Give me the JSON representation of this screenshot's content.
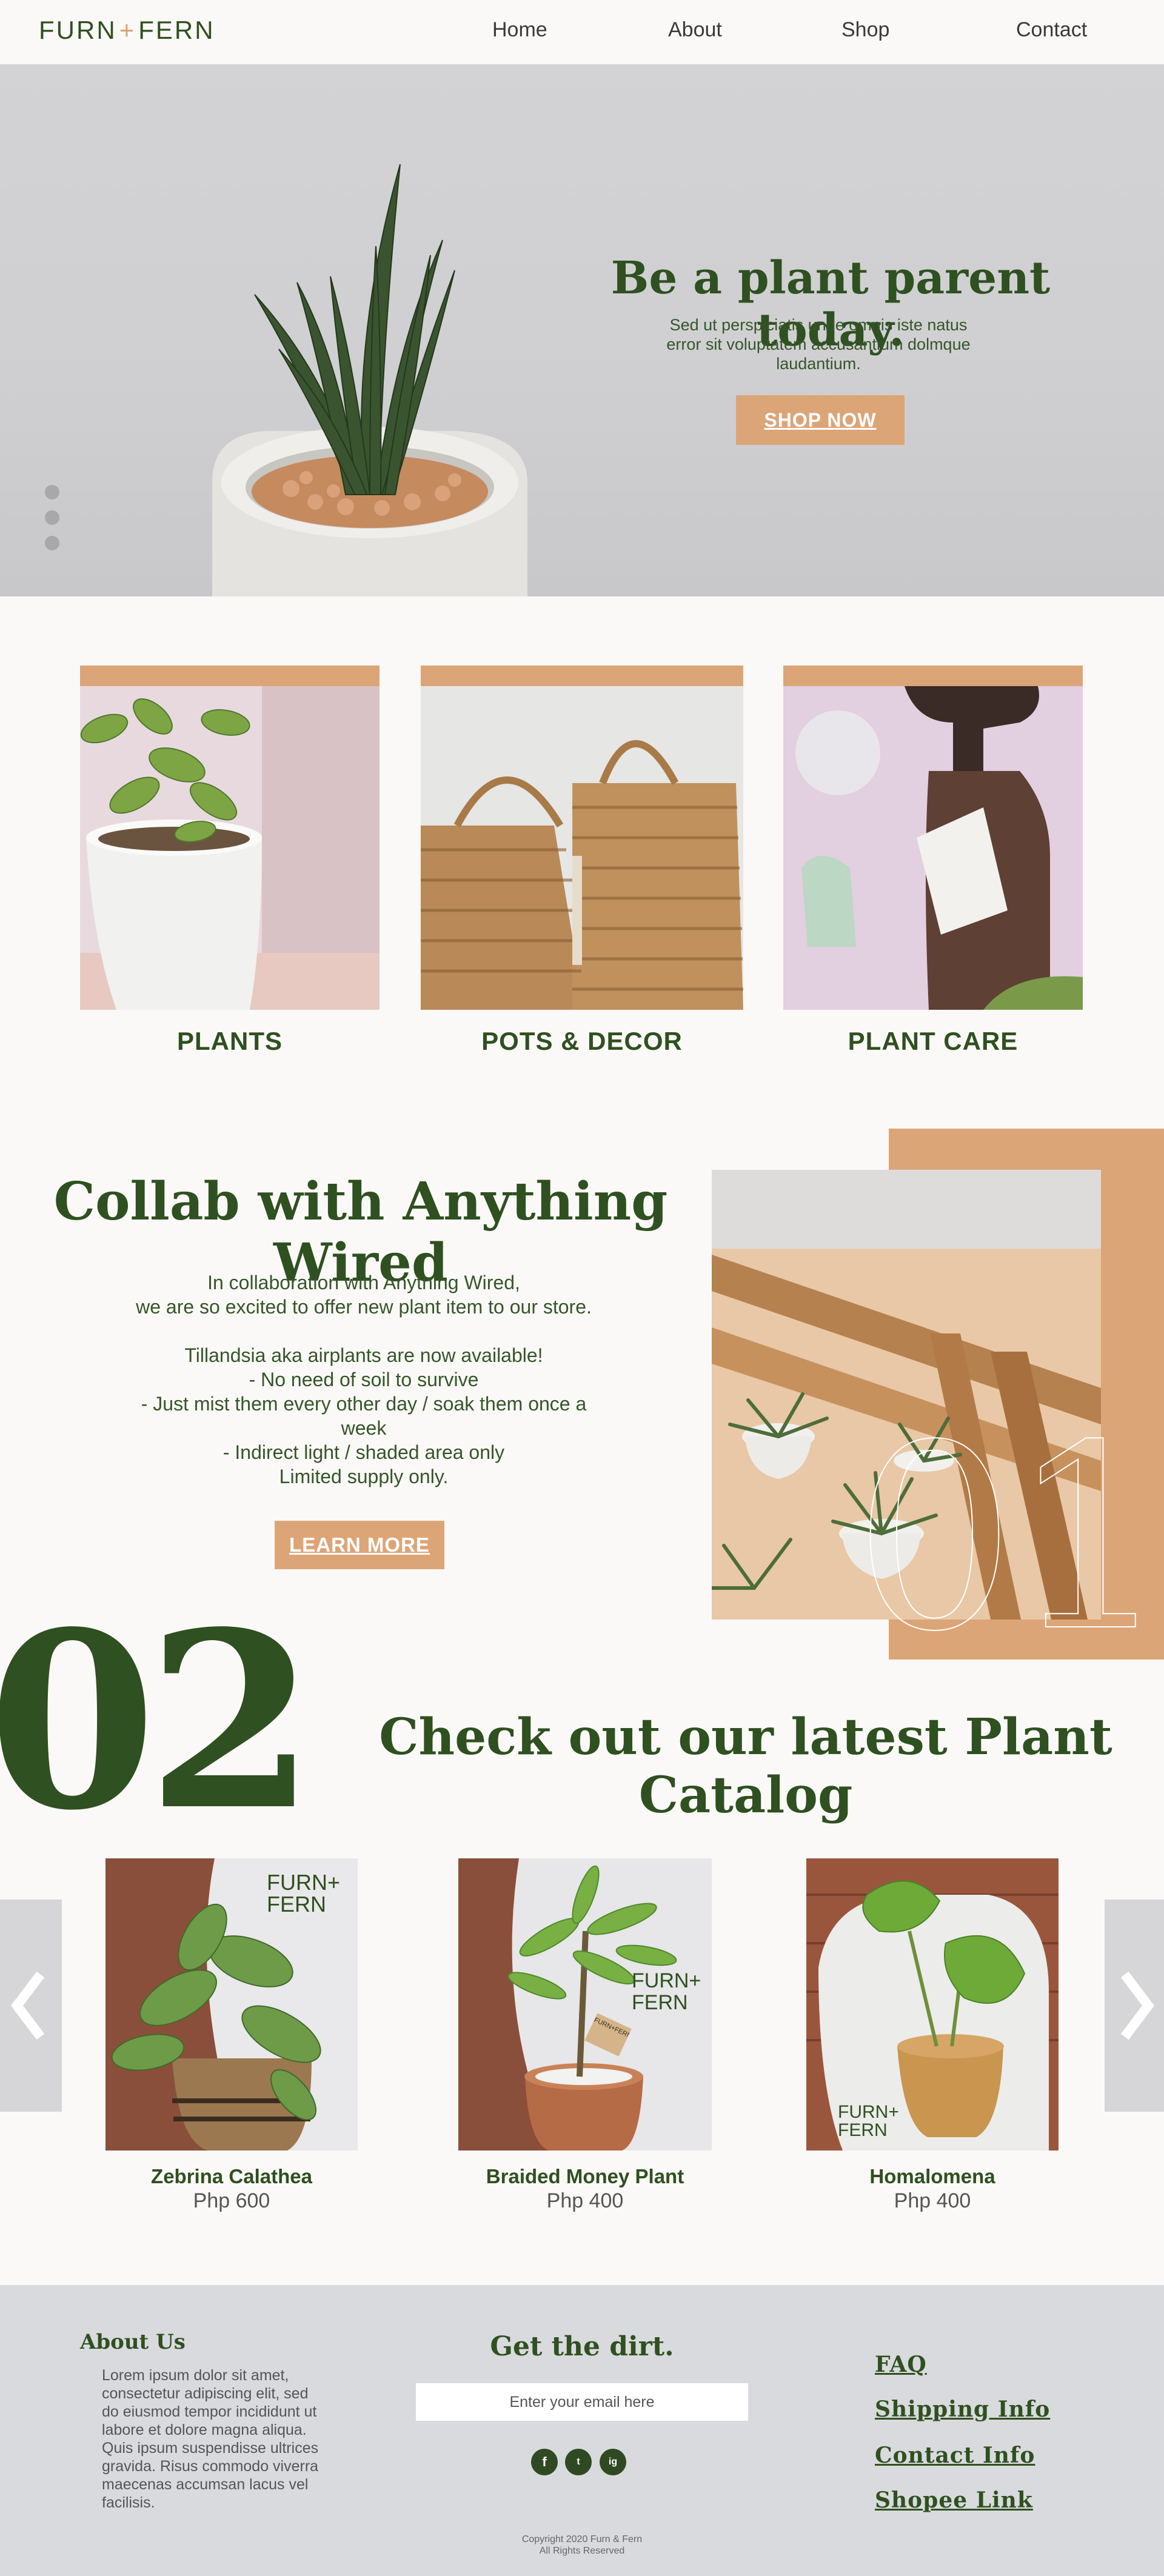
{
  "header": {
    "logo_left": "FURN",
    "logo_plus": "+",
    "logo_right": "FERN",
    "nav": [
      "Home",
      "About",
      "Shop",
      "Contact"
    ]
  },
  "hero": {
    "title": "Be a plant parent today.",
    "subtitle": "Sed ut perspiciatis unde omnis iste natus error sit voluptatem accusantium dolmque laudantium.",
    "button": "SHOP NOW",
    "slides_total": 3,
    "slide_active": 1
  },
  "categories": [
    {
      "label": "PLANTS"
    },
    {
      "label": "POTS & DECOR"
    },
    {
      "label": "PLANT CARE"
    }
  ],
  "collab": {
    "title": "Collab with Anything Wired",
    "intro_1": "In collaboration with Anything Wired,",
    "intro_2": "we are so excited to offer new plant item to our store.",
    "line_1": "Tillandsia aka airplants are now available!",
    "line_2": "- No need of soil to survive",
    "line_3": "- Just mist them every other day / soak them once a week",
    "line_4": "- Indirect light / shaded area only",
    "line_5": "Limited supply only.",
    "button": "LEARN MORE",
    "number": "01"
  },
  "catalog": {
    "number": "02",
    "title": "Check out our latest Plant Catalog",
    "products": [
      {
        "name": "Zebrina Calathea",
        "price": "Php 600"
      },
      {
        "name": "Braided Money Plant",
        "price": "Php 400"
      },
      {
        "name": "Homalomena",
        "price": "Php 400"
      }
    ],
    "brand_tag_line1": "FURN+",
    "brand_tag_line2": "FERN",
    "pot_tag": "FURN+FERN"
  },
  "footer": {
    "about_title": "About Us",
    "about_text": "Lorem ipsum dolor sit amet, consectetur adipiscing elit, sed do eiusmod tempor incididunt ut labore et dolore magna aliqua. Quis ipsum suspendisse ultrices gravida. Risus commodo viverra maecenas accumsan lacus vel facilisis.",
    "newsletter_title": "Get the dirt.",
    "email_placeholder": "Enter your email here",
    "social": [
      "f",
      "t",
      "ig"
    ],
    "links": [
      "FAQ",
      "Shipping Info",
      "Contact Info",
      "Shopee Link"
    ],
    "copyright_1": "Copyright 2020 Furn & Fern",
    "copyright_2": "All Rights Reserved"
  },
  "colors": {
    "brand_green": "#2f5020",
    "accent_tan": "#dca577",
    "background": "#fbf9f7",
    "footer_bg": "#d9dadd"
  }
}
